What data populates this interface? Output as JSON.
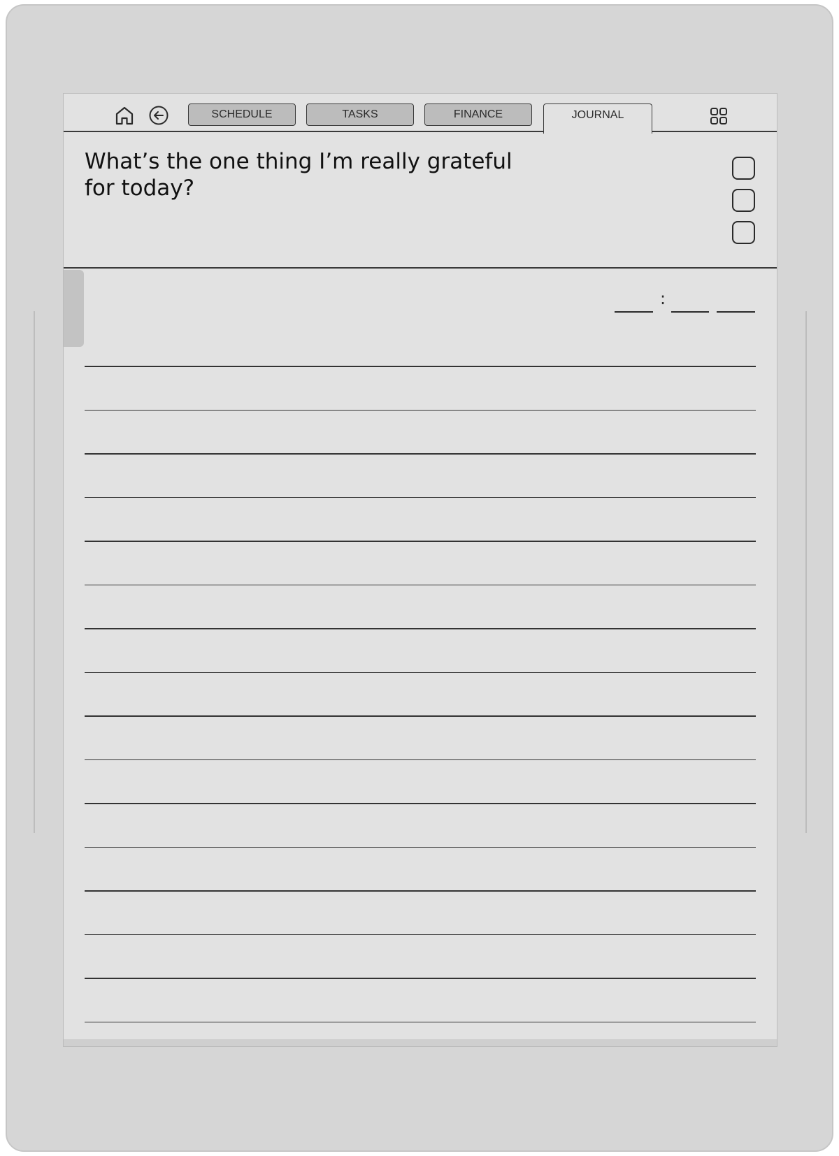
{
  "nav": {
    "home_icon": "home-icon",
    "back_icon": "back-arrow-circle-icon",
    "apps_icon": "grid-apps-icon",
    "tabs": [
      {
        "label": "SCHEDULE",
        "active": false
      },
      {
        "label": "TASKS",
        "active": false
      },
      {
        "label": "FINANCE",
        "active": false
      },
      {
        "label": "JOURNAL",
        "active": true
      }
    ]
  },
  "journal": {
    "prompt": "What’s the one thing I’m really grateful for today?",
    "checkbox_count": 3,
    "time_separator": ":",
    "line_count": 16
  }
}
